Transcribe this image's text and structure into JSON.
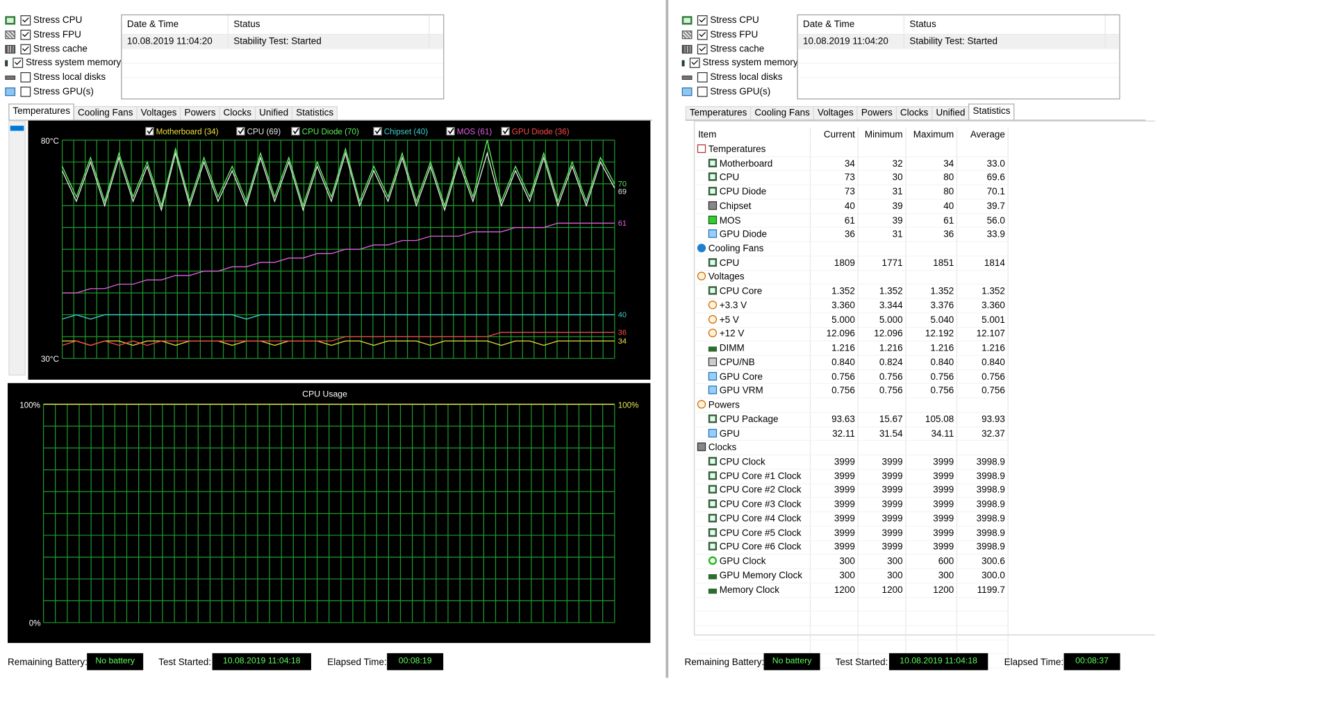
{
  "stress_options": [
    {
      "label": "Stress CPU",
      "checked": true,
      "icon": "cpu-icon"
    },
    {
      "label": "Stress FPU",
      "checked": true,
      "icon": "fpu-icon"
    },
    {
      "label": "Stress cache",
      "checked": true,
      "icon": "cache-icon"
    },
    {
      "label": "Stress system memory",
      "checked": true,
      "icon": "memory-icon"
    },
    {
      "label": "Stress local disks",
      "checked": false,
      "icon": "disk-icon"
    },
    {
      "label": "Stress GPU(s)",
      "checked": false,
      "icon": "gpu-icon"
    }
  ],
  "log": {
    "headers": [
      "Date & Time",
      "Status"
    ],
    "rows": [
      [
        "10.08.2019 11:04:20",
        "Stability Test: Started"
      ]
    ]
  },
  "tabs": [
    "Temperatures",
    "Cooling Fans",
    "Voltages",
    "Powers",
    "Clocks",
    "Unified",
    "Statistics"
  ],
  "left_active_tab": "Temperatures",
  "right_active_tab": "Statistics",
  "temperature_legend": [
    {
      "label": "Motherboard (34)",
      "color": "#f0e040"
    },
    {
      "label": "CPU (69)",
      "color": "#e8e8e8"
    },
    {
      "label": "CPU Diode (70)",
      "color": "#5cf05c"
    },
    {
      "label": "Chipset (40)",
      "color": "#3fd0d0"
    },
    {
      "label": "MOS (61)",
      "color": "#e060e0"
    },
    {
      "label": "GPU Diode (36)",
      "color": "#ff4a4a"
    }
  ],
  "usage_chart_title": "CPU Usage",
  "chart_data": [
    {
      "type": "line",
      "title": "",
      "ylim": [
        30,
        80
      ],
      "y_ticks": [
        "80°C",
        "30°C"
      ],
      "grid": true,
      "legend": "top",
      "series": [
        {
          "name": "Motherboard (34)",
          "color": "#f0e040",
          "end_label": "34",
          "values": [
            34,
            34,
            33,
            34,
            34,
            33,
            34,
            34,
            33,
            34,
            34,
            34,
            33,
            34,
            34,
            33,
            34,
            34,
            34,
            33,
            34,
            34,
            33,
            34,
            34,
            34,
            33,
            34,
            34,
            34,
            34,
            33,
            34,
            34,
            33,
            34,
            34,
            34,
            34,
            34
          ]
        },
        {
          "name": "CPU (69)",
          "color": "#e8e8e8",
          "end_label": "69",
          "values": [
            73,
            66,
            75,
            65,
            76,
            66,
            74,
            64,
            77,
            65,
            75,
            66,
            73,
            65,
            76,
            66,
            75,
            64,
            74,
            66,
            77,
            65,
            73,
            66,
            76,
            65,
            74,
            64,
            75,
            66,
            77,
            65,
            73,
            66,
            76,
            65,
            74,
            65,
            75,
            69
          ]
        },
        {
          "name": "CPU Diode (70)",
          "color": "#5cf05c",
          "end_label": "70",
          "values": [
            74,
            67,
            76,
            66,
            77,
            67,
            75,
            65,
            78,
            66,
            76,
            67,
            74,
            66,
            77,
            67,
            76,
            65,
            75,
            67,
            78,
            66,
            74,
            67,
            77,
            66,
            75,
            65,
            76,
            67,
            80,
            66,
            74,
            67,
            77,
            66,
            75,
            66,
            76,
            70
          ]
        },
        {
          "name": "Chipset (40)",
          "color": "#3fd0d0",
          "end_label": "40",
          "values": [
            39,
            40,
            39,
            40,
            40,
            40,
            40,
            40,
            40,
            40,
            40,
            40,
            40,
            39,
            40,
            40,
            40,
            40,
            40,
            40,
            40,
            40,
            40,
            40,
            40,
            40,
            40,
            40,
            40,
            40,
            40,
            40,
            40,
            40,
            40,
            40,
            40,
            40,
            40,
            40
          ]
        },
        {
          "name": "MOS (61)",
          "color": "#e060e0",
          "end_label": "61",
          "values": [
            45,
            45,
            46,
            46,
            47,
            47,
            48,
            48,
            49,
            49,
            50,
            50,
            51,
            51,
            52,
            52,
            53,
            53,
            54,
            54,
            55,
            55,
            56,
            56,
            57,
            57,
            58,
            58,
            58,
            59,
            59,
            59,
            60,
            60,
            60,
            61,
            61,
            61,
            61,
            61
          ]
        },
        {
          "name": "GPU Diode (36)",
          "color": "#ff4a4a",
          "end_label": "36",
          "values": [
            33,
            34,
            33,
            34,
            33,
            34,
            33,
            34,
            34,
            34,
            34,
            34,
            34,
            34,
            34,
            34,
            34,
            34,
            34,
            34,
            35,
            35,
            35,
            35,
            35,
            35,
            35,
            35,
            35,
            35,
            35,
            36,
            36,
            36,
            36,
            36,
            36,
            36,
            36,
            36
          ]
        }
      ]
    },
    {
      "type": "line",
      "title": "CPU Usage",
      "ylim": [
        0,
        100
      ],
      "y_ticks": [
        "100%",
        "0%"
      ],
      "grid": true,
      "series": [
        {
          "name": "",
          "color": "#e8e850",
          "end_label": "100%",
          "values": [
            100,
            100,
            100,
            100,
            100,
            100,
            100,
            100,
            100,
            100,
            100,
            100,
            100,
            100,
            100,
            100,
            100,
            100,
            100,
            100
          ]
        }
      ]
    }
  ],
  "statistics": {
    "headers": [
      "Item",
      "Current",
      "Minimum",
      "Maximum",
      "Average"
    ],
    "rows": [
      {
        "group": true,
        "item": "Temperatures",
        "icon": "temperature-icon"
      },
      {
        "item": "Motherboard",
        "icon": "motherboard-icon",
        "cur": "34",
        "min": "32",
        "max": "34",
        "avg": "33.0"
      },
      {
        "item": "CPU",
        "icon": "cpu-icon",
        "cur": "73",
        "min": "30",
        "max": "80",
        "avg": "69.6"
      },
      {
        "item": "CPU Diode",
        "icon": "cpu-icon",
        "cur": "73",
        "min": "31",
        "max": "80",
        "avg": "70.1"
      },
      {
        "item": "Chipset",
        "icon": "chipset-icon",
        "cur": "40",
        "min": "39",
        "max": "40",
        "avg": "39.7"
      },
      {
        "item": "MOS",
        "icon": "mos-icon",
        "cur": "61",
        "min": "39",
        "max": "61",
        "avg": "56.0"
      },
      {
        "item": "GPU Diode",
        "icon": "gpu-icon",
        "cur": "36",
        "min": "31",
        "max": "36",
        "avg": "33.9"
      },
      {
        "group": true,
        "item": "Cooling Fans",
        "icon": "fan-icon"
      },
      {
        "item": "CPU",
        "icon": "cpu-icon",
        "cur": "1809",
        "min": "1771",
        "max": "1851",
        "avg": "1814"
      },
      {
        "group": true,
        "item": "Voltages",
        "icon": "voltage-icon"
      },
      {
        "item": "CPU Core",
        "icon": "cpu-icon",
        "cur": "1.352",
        "min": "1.352",
        "max": "1.352",
        "avg": "1.352"
      },
      {
        "item": "+3.3 V",
        "icon": "voltage-icon",
        "cur": "3.360",
        "min": "3.344",
        "max": "3.376",
        "avg": "3.360"
      },
      {
        "item": "+5 V",
        "icon": "voltage-icon",
        "cur": "5.000",
        "min": "5.000",
        "max": "5.040",
        "avg": "5.001"
      },
      {
        "item": "+12 V",
        "icon": "voltage-icon",
        "cur": "12.096",
        "min": "12.096",
        "max": "12.192",
        "avg": "12.107"
      },
      {
        "item": "DIMM",
        "icon": "memory-icon",
        "cur": "1.216",
        "min": "1.216",
        "max": "1.216",
        "avg": "1.216"
      },
      {
        "item": "CPU/NB",
        "icon": "chip-icon",
        "cur": "0.840",
        "min": "0.824",
        "max": "0.840",
        "avg": "0.840"
      },
      {
        "item": "GPU Core",
        "icon": "gpu-icon",
        "cur": "0.756",
        "min": "0.756",
        "max": "0.756",
        "avg": "0.756"
      },
      {
        "item": "GPU VRM",
        "icon": "gpu-icon",
        "cur": "0.756",
        "min": "0.756",
        "max": "0.756",
        "avg": "0.756"
      },
      {
        "group": true,
        "item": "Powers",
        "icon": "power-icon"
      },
      {
        "item": "CPU Package",
        "icon": "cpu-icon",
        "cur": "93.63",
        "min": "15.67",
        "max": "105.08",
        "avg": "93.93"
      },
      {
        "item": "GPU",
        "icon": "gpu-icon",
        "cur": "32.11",
        "min": "31.54",
        "max": "34.11",
        "avg": "32.37"
      },
      {
        "group": true,
        "item": "Clocks",
        "icon": "clock-icon"
      },
      {
        "item": "CPU Clock",
        "icon": "cpu-icon",
        "cur": "3999",
        "min": "3999",
        "max": "3999",
        "avg": "3998.9"
      },
      {
        "item": "CPU Core #1 Clock",
        "icon": "cpu-icon",
        "cur": "3999",
        "min": "3999",
        "max": "3999",
        "avg": "3998.9"
      },
      {
        "item": "CPU Core #2 Clock",
        "icon": "cpu-icon",
        "cur": "3999",
        "min": "3999",
        "max": "3999",
        "avg": "3998.9"
      },
      {
        "item": "CPU Core #3 Clock",
        "icon": "cpu-icon",
        "cur": "3999",
        "min": "3999",
        "max": "3999",
        "avg": "3998.9"
      },
      {
        "item": "CPU Core #4 Clock",
        "icon": "cpu-icon",
        "cur": "3999",
        "min": "3999",
        "max": "3999",
        "avg": "3998.9"
      },
      {
        "item": "CPU Core #5 Clock",
        "icon": "cpu-icon",
        "cur": "3999",
        "min": "3999",
        "max": "3999",
        "avg": "3998.9"
      },
      {
        "item": "CPU Core #6 Clock",
        "icon": "cpu-icon",
        "cur": "3999",
        "min": "3999",
        "max": "3999",
        "avg": "3998.9"
      },
      {
        "item": "GPU Clock",
        "icon": "xbox-icon",
        "cur": "300",
        "min": "300",
        "max": "600",
        "avg": "300.6"
      },
      {
        "item": "GPU Memory Clock",
        "icon": "memory-icon",
        "cur": "300",
        "min": "300",
        "max": "300",
        "avg": "300.0"
      },
      {
        "item": "Memory Clock",
        "icon": "memory-icon",
        "cur": "1200",
        "min": "1200",
        "max": "1200",
        "avg": "1199.7"
      }
    ]
  },
  "footer_left": {
    "battery_label": "Remaining Battery:",
    "battery_value": "No battery",
    "started_label": "Test Started:",
    "started_value": "10.08.2019 11:04:18",
    "elapsed_label": "Elapsed Time:",
    "elapsed_value": "00:08:19"
  },
  "footer_right": {
    "battery_label": "Remaining Battery:",
    "battery_value": "No battery",
    "started_label": "Test Started:",
    "started_value": "10.08.2019 11:04:18",
    "elapsed_label": "Elapsed Time:",
    "elapsed_value": "00:08:37"
  }
}
